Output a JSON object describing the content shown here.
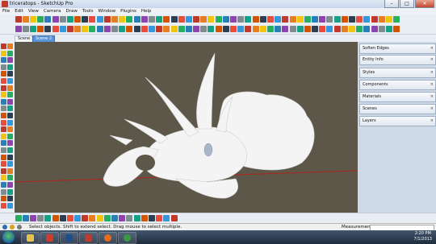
{
  "window": {
    "title": "triceratops - SketchUp Pro",
    "minimize": "–",
    "maximize": "□",
    "close": "✕"
  },
  "menu": [
    "File",
    "Edit",
    "View",
    "Camera",
    "Draw",
    "Tools",
    "Window",
    "Plugins",
    "Help"
  ],
  "scenes": [
    "Scene 1",
    "Scene 2"
  ],
  "trays": [
    {
      "label": "Soften Edges",
      "close": "×"
    },
    {
      "label": "Entity Info",
      "close": "×"
    },
    {
      "label": "Styles",
      "close": "×"
    },
    {
      "label": "Components",
      "close": "×"
    },
    {
      "label": "Materials",
      "close": "×"
    },
    {
      "label": "Scenes",
      "close": "×"
    },
    {
      "label": "Layers",
      "close": "×"
    }
  ],
  "status": {
    "message": "Select objects. Shift to extend select. Drag mouse to select multiple.",
    "measurements_label": "Measurements"
  },
  "clock": {
    "time": "2:20 PM",
    "date": "7/1/2013"
  },
  "colors": {
    "viewport_bg": "#5c5749",
    "model": "#f4f4f4",
    "red_axis": "#b0241c",
    "tray_bg": "#ced9e7"
  }
}
